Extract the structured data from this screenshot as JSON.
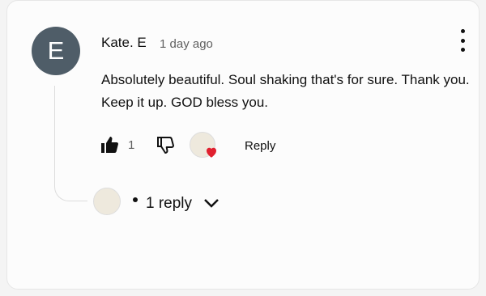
{
  "comment": {
    "author_initial": "E",
    "author": "Kate. E",
    "time": "1 day ago",
    "text": "Absolutely beautiful. Soul shaking that's for sure.  Thank you. Keep it up.  GOD bless you.",
    "likes": "1",
    "reply_label": "Reply",
    "replies_label": "1 reply"
  },
  "colors": {
    "avatar_bg": "#4f5d68",
    "heart": "#e0202f"
  },
  "icons": [
    "thumbs-up-icon",
    "thumbs-down-icon",
    "heart-icon",
    "more-vert-icon",
    "chevron-down-icon"
  ]
}
